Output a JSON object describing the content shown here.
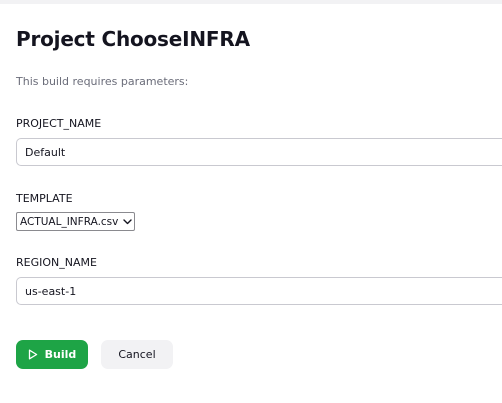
{
  "page": {
    "title": "Project ChooseINFRA",
    "subtitle": "This build requires parameters:"
  },
  "params": {
    "project_name": {
      "label": "PROJECT_NAME",
      "value": "Default"
    },
    "template": {
      "label": "TEMPLATE",
      "selected": "ACTUAL_INFRA.csv"
    },
    "region_name": {
      "label": "REGION_NAME",
      "value": "us-east-1"
    }
  },
  "actions": {
    "build_label": "Build",
    "cancel_label": "Cancel"
  },
  "icons": {
    "build": "play-icon",
    "select": "chevron-down-icon"
  },
  "colors": {
    "build_button": "#1ea446",
    "cancel_button": "#f2f2f4",
    "subtitle_text": "#6b6d7a",
    "field_border": "#c9c9d0"
  }
}
